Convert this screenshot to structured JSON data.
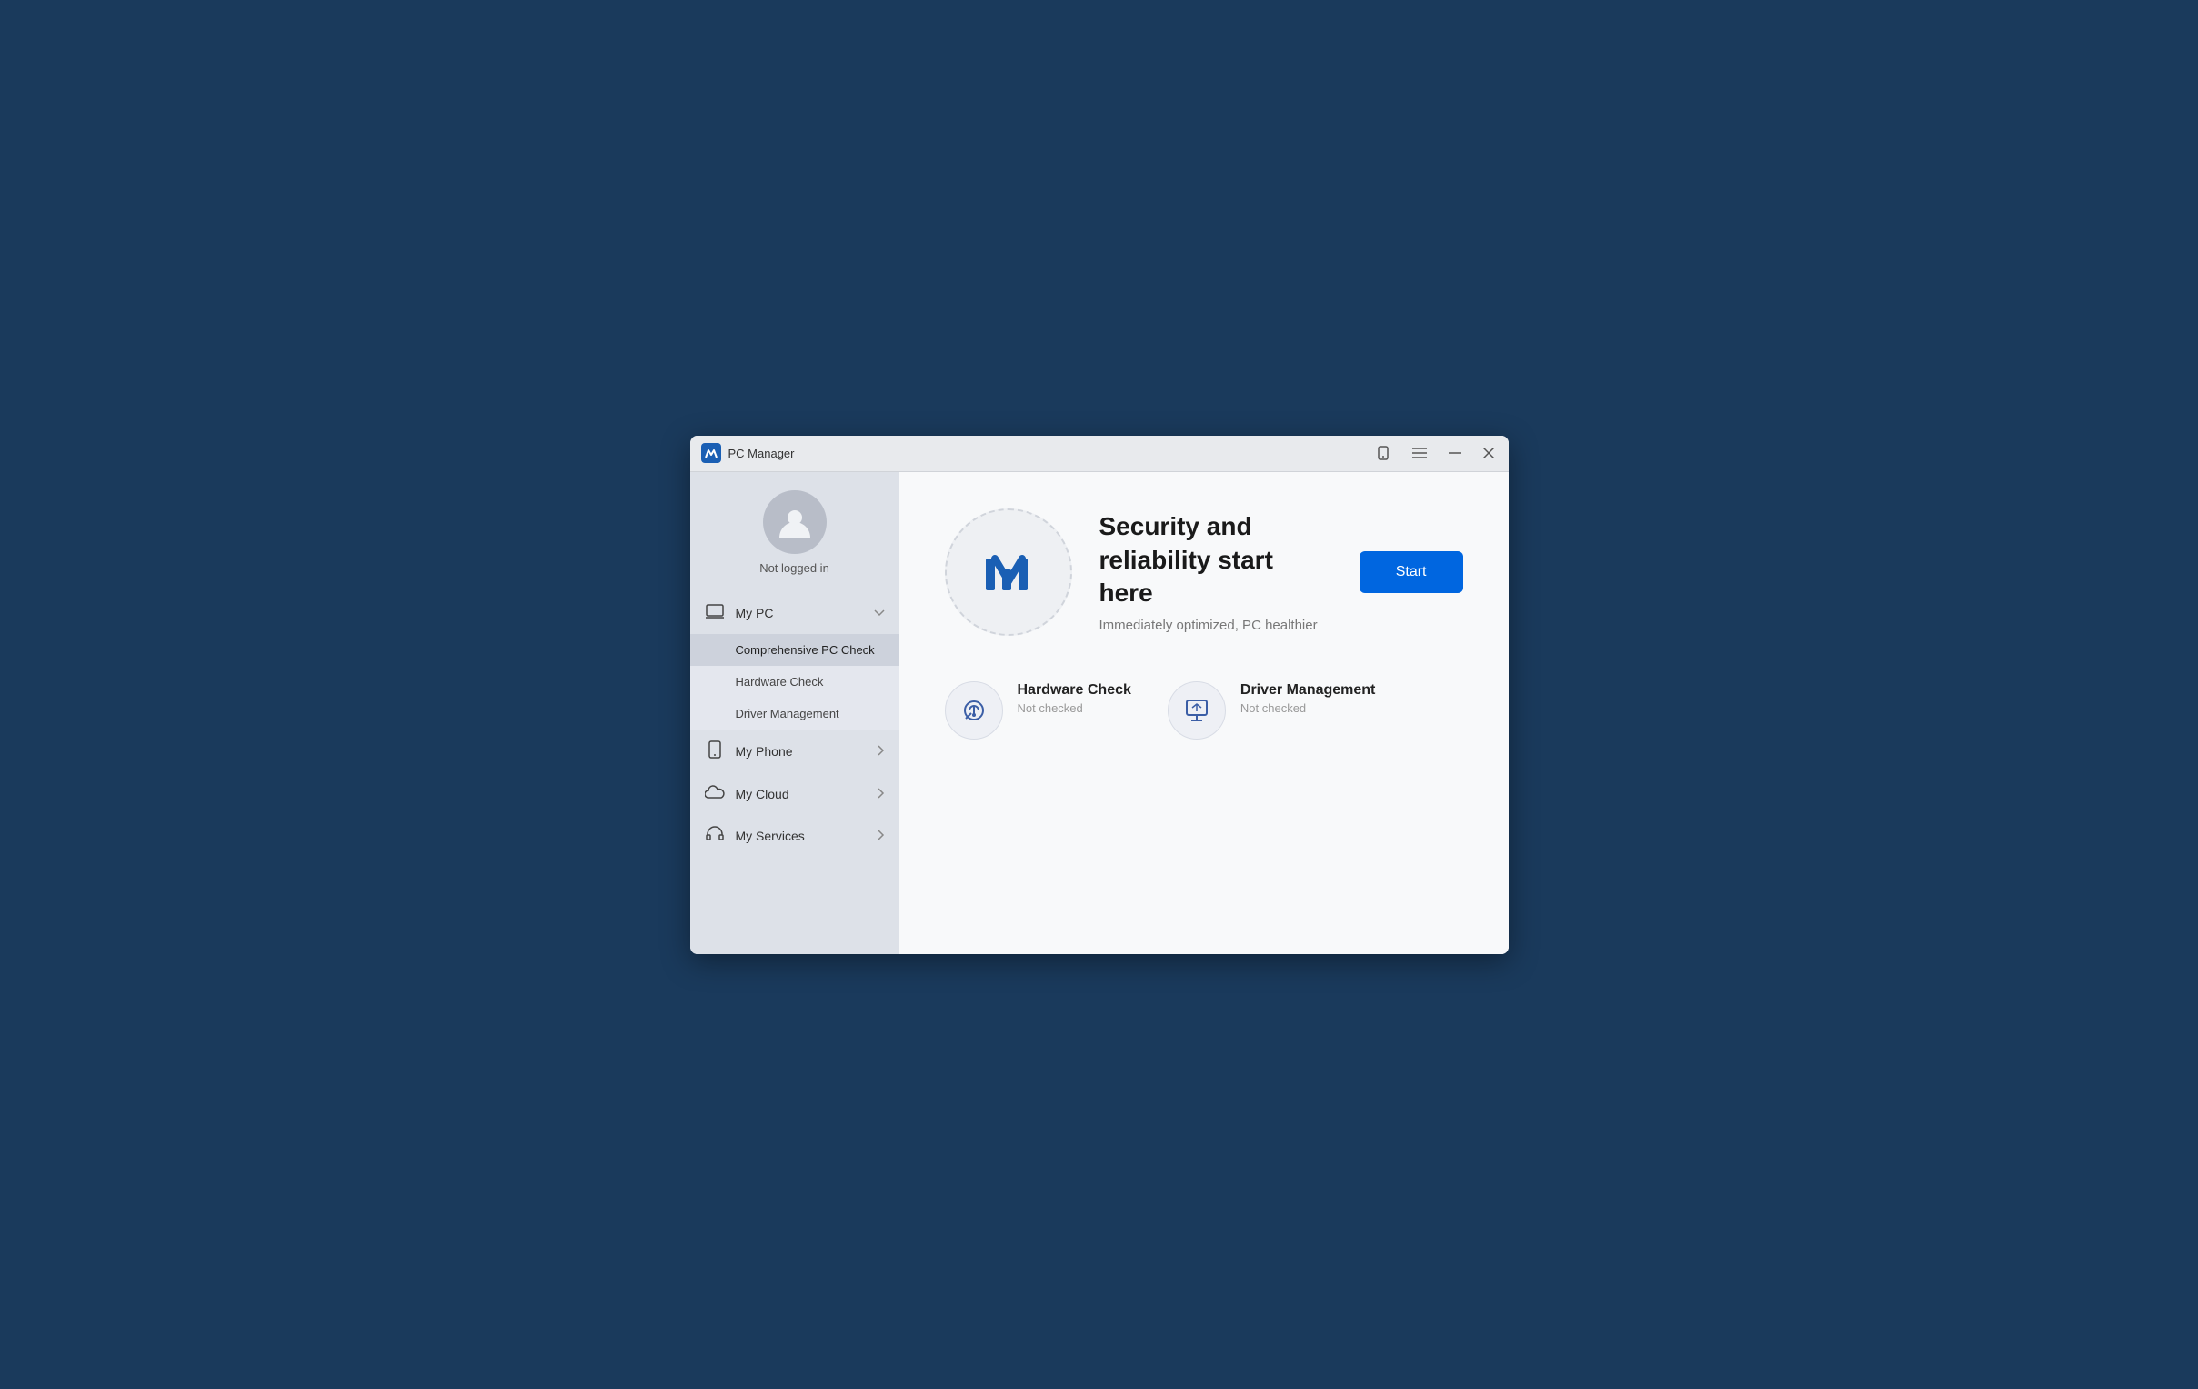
{
  "window": {
    "title": "PC Manager"
  },
  "titlebar": {
    "title": "PC Manager",
    "phone_icon": "📱",
    "menu_icon": "☰",
    "minimize_icon": "─",
    "close_icon": "✕"
  },
  "sidebar": {
    "user": {
      "status": "Not logged in"
    },
    "nav_items": [
      {
        "id": "my-pc",
        "label": "My PC",
        "icon": "💻",
        "chevron": "∨",
        "expanded": true,
        "sub_items": [
          {
            "id": "comprehensive-pc-check",
            "label": "Comprehensive PC Check",
            "active": true
          },
          {
            "id": "hardware-check",
            "label": "Hardware Check",
            "active": false
          },
          {
            "id": "driver-management",
            "label": "Driver Management",
            "active": false
          }
        ]
      },
      {
        "id": "my-phone",
        "label": "My Phone",
        "icon": "📱",
        "chevron": ">",
        "expanded": false
      },
      {
        "id": "my-cloud",
        "label": "My Cloud",
        "icon": "☁",
        "chevron": ">",
        "expanded": false
      },
      {
        "id": "my-services",
        "label": "My Services",
        "icon": "🎧",
        "chevron": ">",
        "expanded": false
      }
    ]
  },
  "content": {
    "hero": {
      "title": "Security and reliability start here",
      "subtitle": "Immediately optimized, PC healthier",
      "start_button": "Start"
    },
    "cards": [
      {
        "id": "hardware-check",
        "title": "Hardware Check",
        "status": "Not checked"
      },
      {
        "id": "driver-management",
        "title": "Driver Management",
        "status": "Not checked"
      }
    ]
  }
}
